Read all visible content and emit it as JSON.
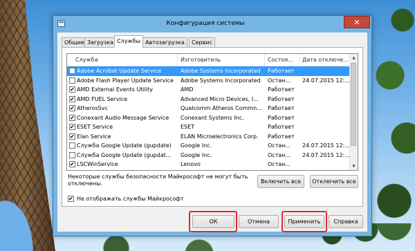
{
  "window": {
    "title": "Конфигурация системы",
    "close_glyph": "✕"
  },
  "tabs": [
    "Общие",
    "Загрузка",
    "Службы",
    "Автозагрузка",
    "Сервис"
  ],
  "active_tab": 2,
  "columns": {
    "service": "Служба",
    "manufacturer": "Изготовитель",
    "status": "Состоя...",
    "date": "Дата отключе..."
  },
  "services": [
    {
      "checked": false,
      "name": "Adobe Acrobat Update Service",
      "manufacturer": "Adobe Systems Incorporated",
      "status": "Работает",
      "date": "",
      "selected": true
    },
    {
      "checked": false,
      "name": "Adobe Flash Player Update Service",
      "manufacturer": "Adobe Systems Incorporated",
      "status": "Остан...",
      "date": "24.07.2015 12:..."
    },
    {
      "checked": true,
      "name": "AMD External Events Utility",
      "manufacturer": "AMD",
      "status": "Работает",
      "date": ""
    },
    {
      "checked": true,
      "name": "AMD FUEL Service",
      "manufacturer": "Advanced Micro Devices, I...",
      "status": "Работает",
      "date": ""
    },
    {
      "checked": true,
      "name": "AtherosSvc",
      "manufacturer": "Qualcomm Atheros Commn...",
      "status": "Работает",
      "date": ""
    },
    {
      "checked": true,
      "name": "Conexant Audio Message Service",
      "manufacturer": "Conexant Systems Inc.",
      "status": "Работает",
      "date": ""
    },
    {
      "checked": true,
      "name": "ESET Service",
      "manufacturer": "ESET",
      "status": "Работает",
      "date": ""
    },
    {
      "checked": true,
      "name": "Elan Service",
      "manufacturer": "ELAN Microelectronics Corp.",
      "status": "Работает",
      "date": ""
    },
    {
      "checked": false,
      "name": "Служба Google Update (gupdate)",
      "manufacturer": "Google Inc.",
      "status": "Остан...",
      "date": "24.07.2015 12:..."
    },
    {
      "checked": false,
      "name": "Служба Google Update (gupdat...",
      "manufacturer": "Google Inc.",
      "status": "Остан...",
      "date": "24.07.2015 12:..."
    },
    {
      "checked": true,
      "name": "LSCWinService",
      "manufacturer": "Lenovo",
      "status": "Остан...",
      "date": ""
    }
  ],
  "note": "Некоторые службы безопасности Майкрософт не могут быть отключены.",
  "buttons": {
    "enable_all": "Включить все",
    "disable_all": "Отключить все",
    "ok": "ОК",
    "cancel": "Отмена",
    "apply": "Применить",
    "help": "Справка"
  },
  "hide_ms": {
    "checked": true,
    "label": "Не отображать службы Майкрософт"
  },
  "highlight_color": "#e0292c",
  "check_glyph": "✔"
}
